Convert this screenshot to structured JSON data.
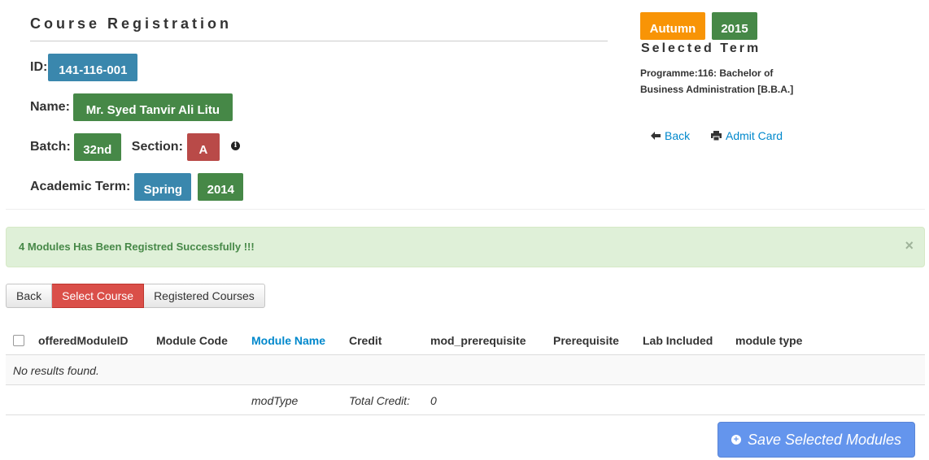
{
  "header": {
    "title": "Course Registration"
  },
  "student": {
    "id_label": "ID:",
    "id_value": "141-116-001",
    "name_label": "Name:",
    "name_value": "Mr. Syed Tanvir Ali Litu",
    "batch_label": "Batch:",
    "batch_value": "32nd",
    "section_label": "Section:",
    "section_value": "A",
    "term_label": "Academic Term:",
    "term_season": "Spring",
    "term_year": "2014"
  },
  "selected_term": {
    "season": "Autumn",
    "year": "2015",
    "heading": "Selected Term",
    "programme": "Programme:116: Bachelor of Business Administration [B.B.A.]"
  },
  "links": {
    "back": "Back",
    "admit_card": "Admit Card"
  },
  "alert": {
    "message": "4 Modules Has Been Registred Successfully !!!",
    "close": "×"
  },
  "tabs": {
    "back": "Back",
    "select_course": "Select Course",
    "registered_courses": "Registered Courses"
  },
  "table": {
    "columns": [
      "offeredModuleID",
      "Module Code",
      "Module Name",
      "Credit",
      "mod_prerequisite",
      "Prerequisite",
      "Lab Included",
      "module type"
    ],
    "empty_message": "No results found.",
    "footer": {
      "mod_type": "modType",
      "total_credit_label": "Total Credit:",
      "total_credit_value": "0"
    }
  },
  "save_button": "Save Selected Modules",
  "colors": {
    "blue_badge": "#3a87ad",
    "green_badge": "#468847",
    "red_badge": "#b94a48",
    "orange_badge": "#f89406",
    "alert_bg": "#dff0d8",
    "save_btn": "#6495ed"
  }
}
